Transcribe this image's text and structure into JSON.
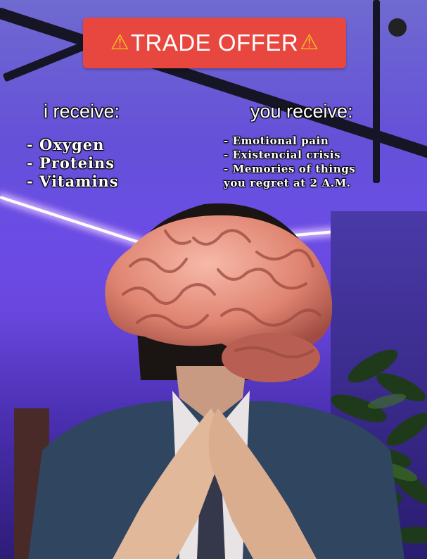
{
  "banner": {
    "title": "TRADE OFFER",
    "icon_left": "warning-icon",
    "icon_right": "warning-icon",
    "color": "#e8473f"
  },
  "left": {
    "heading": "i receive:",
    "items": [
      "- Oxygen",
      "- Proteins",
      "- Vitamins"
    ]
  },
  "right": {
    "heading": "you receive:",
    "items": [
      "- Emotional pain",
      "- Existencial crisis",
      "- Memories of things",
      "you regret at 2 A.M."
    ]
  },
  "scene": {
    "background_color": "#6b4ee6",
    "subject": "brain-over-face-icon"
  }
}
